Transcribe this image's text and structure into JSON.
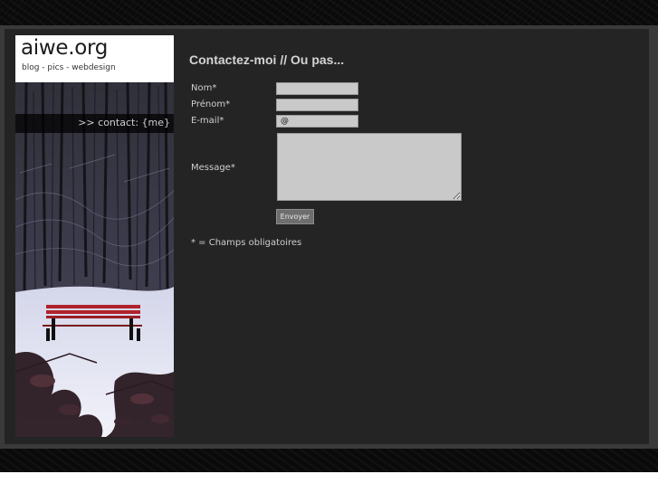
{
  "site": {
    "title": "aiwe.org",
    "tagline": "blog - pics - webdesign"
  },
  "nav": {
    "contact_link": ">> contact: {me}"
  },
  "page": {
    "heading": "Contactez-moi // Ou pas..."
  },
  "form": {
    "nom_label": "Nom*",
    "prenom_label": "Prénom*",
    "email_label": "E-mail*",
    "email_value": "@",
    "message_label": "Message*",
    "submit_label": "Envoyer",
    "required_note": "* = Champs obligatoires"
  },
  "photo": {
    "subject": "snowy-forest-red-bench",
    "bench_color": "#b0222c"
  }
}
